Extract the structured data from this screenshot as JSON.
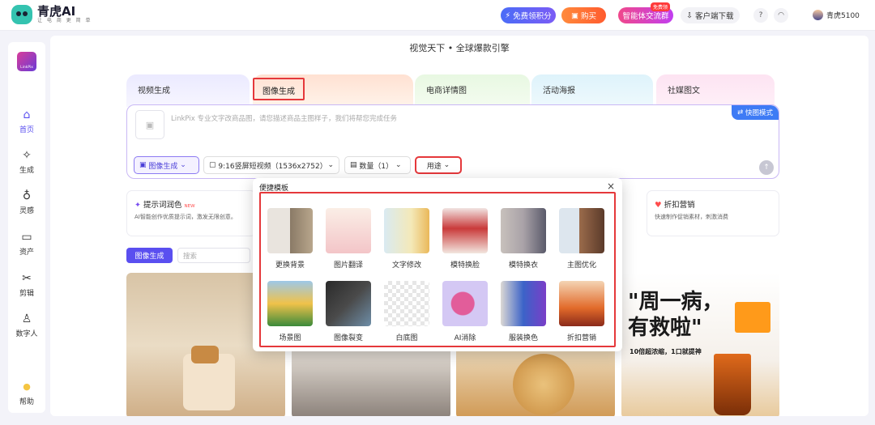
{
  "app": {
    "name": "青虎AI",
    "tagline": "让 电 商 更 简 单"
  },
  "topbar": {
    "free_points": "免费领积分",
    "buy": "购买",
    "community": "智能体交流群",
    "community_badge": "免费领",
    "client_download": "客户端下载",
    "user_name": "青虎5100"
  },
  "sidebar": {
    "logo_text": "LinkPix",
    "items": [
      {
        "label": "首页",
        "icon": "home-icon"
      },
      {
        "label": "生成",
        "icon": "sparkle-icon"
      },
      {
        "label": "灵感",
        "icon": "lightbulb-icon"
      },
      {
        "label": "资产",
        "icon": "folder-icon"
      },
      {
        "label": "剪辑",
        "icon": "scissors-icon"
      },
      {
        "label": "数字人",
        "icon": "person-icon"
      }
    ],
    "help": "帮助"
  },
  "main": {
    "headline": "视觉天下 • 全球爆款引擎",
    "tabs": [
      "视频生成",
      "图像生成",
      "电商详情图",
      "活动海报",
      "社媒图文"
    ],
    "prompt_placeholder": "LinkPix 专业文字改商品图，请您描述商品主图样子，我们将帮您完成任务",
    "quick_mode": "快图模式",
    "mode": "图像生成",
    "ratio": "9:16竖屏短视频（1536x2752）",
    "quantity": "数量（1）",
    "usage": "用途",
    "feature_left_title": "提示词润色",
    "feature_left_tag": "NEW",
    "feature_left_desc": "AI智能创作优质提示词，激发无限创意。",
    "feature_right_title": "折扣营销",
    "feature_right_desc": "快速制作促销素材，刺激消费",
    "gallery_filter": "图像生成",
    "search_placeholder": "搜索",
    "poster_big_1": "\"周一病，",
    "poster_big_2": "有救啦\"",
    "poster_sub": "10倍超浓缩，1口就提神"
  },
  "popup": {
    "title": "便捷模板",
    "templates": [
      "更换背景",
      "图片翻译",
      "文字修改",
      "模特换脸",
      "模特换衣",
      "主图优化",
      "场景图",
      "图像裂变",
      "白底图",
      "AI消除",
      "服装换色",
      "折扣营销"
    ]
  },
  "colors": {
    "accent": "#5a4ff0",
    "highlight": "#e5383b",
    "quick_mode": "#3e7bf5"
  }
}
